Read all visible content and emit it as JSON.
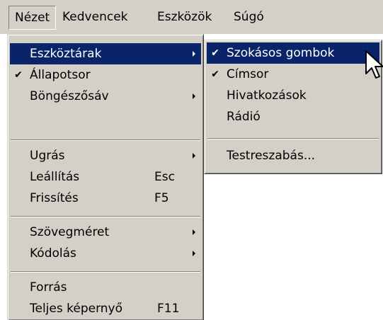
{
  "menubar": {
    "items": [
      {
        "label": "Nézet"
      },
      {
        "label": "Kedvencek"
      },
      {
        "label": "Eszközök"
      },
      {
        "label": "Súgó"
      }
    ]
  },
  "view_menu": {
    "items": [
      {
        "label": "Eszköztárak",
        "shortcut": "",
        "checked": false,
        "submenu": true,
        "highlighted": true
      },
      {
        "label": "Állapotsor",
        "shortcut": "",
        "checked": true,
        "submenu": false
      },
      {
        "label": "Böngészősáv",
        "shortcut": "",
        "checked": false,
        "submenu": true
      },
      {
        "label": "Ugrás",
        "shortcut": "",
        "checked": false,
        "submenu": true
      },
      {
        "label": "Leállítás",
        "shortcut": "Esc",
        "checked": false,
        "submenu": false
      },
      {
        "label": "Frissítés",
        "shortcut": "F5",
        "checked": false,
        "submenu": false
      },
      {
        "label": "Szövegméret",
        "shortcut": "",
        "checked": false,
        "submenu": true
      },
      {
        "label": "Kódolás",
        "shortcut": "",
        "checked": false,
        "submenu": true
      },
      {
        "label": "Forrás",
        "shortcut": "",
        "checked": false,
        "submenu": false
      },
      {
        "label": "Teljes képernyő",
        "shortcut": "F11",
        "checked": false,
        "submenu": false
      }
    ]
  },
  "toolbars_submenu": {
    "items": [
      {
        "label": "Szokásos gombok",
        "checked": true,
        "highlighted": true
      },
      {
        "label": "Címsor",
        "checked": true
      },
      {
        "label": "Hivatkozások",
        "checked": false
      },
      {
        "label": "Rádió",
        "checked": false
      },
      {
        "label": "Testreszabás...",
        "checked": false
      }
    ]
  },
  "glyphs": {
    "check": "✔"
  },
  "colors": {
    "menu_bg": "#d4d0c8",
    "highlight": "#0a246a",
    "highlight_text": "#ffffff"
  }
}
